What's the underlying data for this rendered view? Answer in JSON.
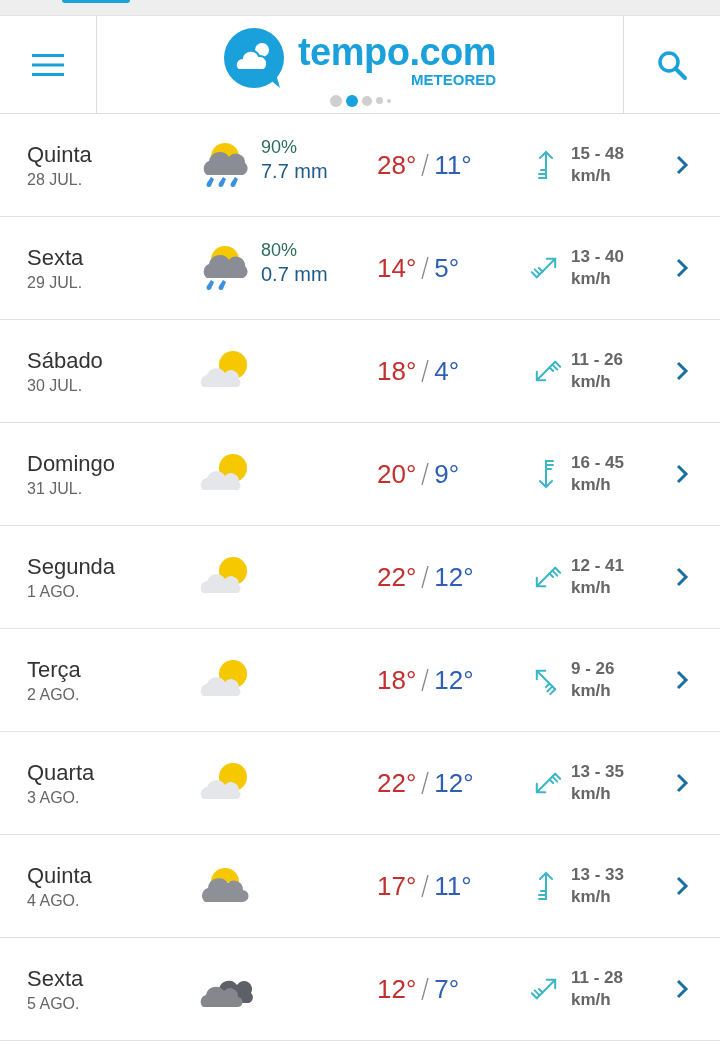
{
  "header": {
    "logo_text": "tempo.com",
    "logo_subtext": "METEORED",
    "carousel_dots": [
      {
        "selected": false
      },
      {
        "selected": true
      },
      {
        "selected": false
      },
      {
        "selected": false
      },
      {
        "selected": false
      }
    ]
  },
  "days": [
    {
      "day": "Quinta",
      "date": "28 JUL.",
      "kind": "rain",
      "rain_chance": "90%",
      "rain_amount": "7.7 mm",
      "max": "28°",
      "min": "11°",
      "wind_arrow": {
        "kind": "north"
      },
      "wind": "15 - 48",
      "wind_unit": "km/h"
    },
    {
      "day": "Sexta",
      "date": "29 JUL.",
      "kind": "rain",
      "rain_chance": "80%",
      "rain_amount": "0.7 mm",
      "max": "14°",
      "min": "5°",
      "wind_arrow": {
        "kind": "northeast"
      },
      "wind": "13 - 40",
      "wind_unit": "km/h"
    },
    {
      "day": "Sábado",
      "date": "30 JUL.",
      "kind": "partly",
      "max": "18°",
      "min": "4°",
      "wind_arrow": {
        "kind": "southwest"
      },
      "wind": "11 - 26",
      "wind_unit": "km/h"
    },
    {
      "day": "Domingo",
      "date": "31 JUL.",
      "kind": "partly",
      "max": "20°",
      "min": "9°",
      "wind_arrow": {
        "kind": "south"
      },
      "wind": "16 - 45",
      "wind_unit": "km/h"
    },
    {
      "day": "Segunda",
      "date": "1 AGO.",
      "kind": "partly",
      "max": "22°",
      "min": "12°",
      "wind_arrow": {
        "kind": "southwest"
      },
      "wind": "12 - 41",
      "wind_unit": "km/h"
    },
    {
      "day": "Terça",
      "date": "2 AGO.",
      "kind": "partly",
      "max": "18°",
      "min": "12°",
      "wind_arrow": {
        "kind": "northwest"
      },
      "wind": "9 - 26",
      "wind_unit": "km/h"
    },
    {
      "day": "Quarta",
      "date": "3 AGO.",
      "kind": "partly",
      "max": "22°",
      "min": "12°",
      "wind_arrow": {
        "kind": "southwest"
      },
      "wind": "13 - 35",
      "wind_unit": "km/h"
    },
    {
      "day": "Quinta",
      "date": "4 AGO.",
      "kind": "cloudy",
      "max": "17°",
      "min": "11°",
      "wind_arrow": {
        "kind": "north"
      },
      "wind": "13 - 33",
      "wind_unit": "km/h"
    },
    {
      "day": "Sexta",
      "date": "5 AGO.",
      "kind": "overcast",
      "max": "12°",
      "min": "7°",
      "wind_arrow": {
        "kind": "northeast"
      },
      "wind": "11 - 28",
      "wind_unit": "km/h"
    }
  ]
}
